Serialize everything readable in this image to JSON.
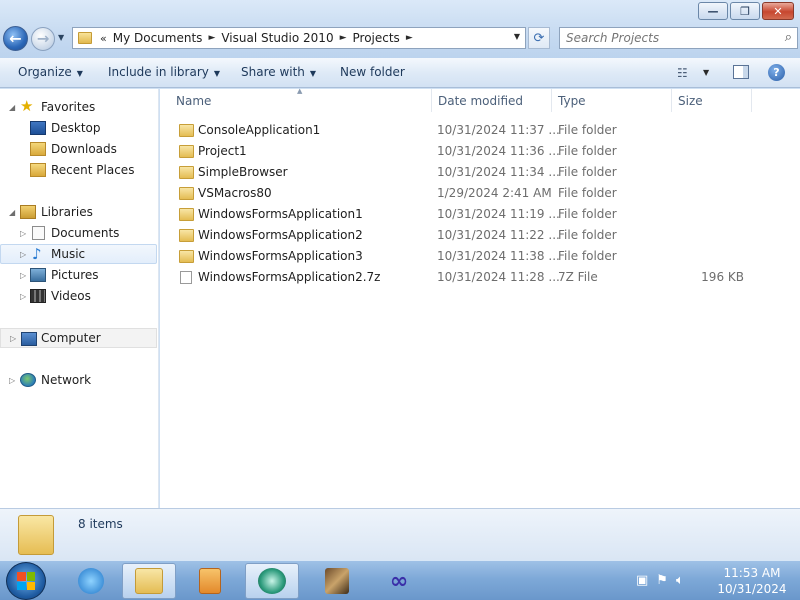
{
  "window": {
    "buttons": {
      "minimize": "—",
      "maximize": "❐",
      "close": "✕"
    }
  },
  "navigation": {
    "back_glyph": "←",
    "forward_glyph": "→",
    "breadcrumb_overflow": "«",
    "breadcrumbs": [
      "My Documents",
      "Visual Studio 2010",
      "Projects"
    ],
    "separator": "►",
    "refresh_glyph": "⟳",
    "search_placeholder": "Search Projects"
  },
  "toolbar": {
    "organize": "Organize",
    "include_in_library": "Include in library",
    "share_with": "Share with",
    "new_folder": "New folder",
    "help": "?"
  },
  "nav_pane": {
    "favorites": "Favorites",
    "desktop": "Desktop",
    "downloads": "Downloads",
    "recent_places": "Recent Places",
    "libraries": "Libraries",
    "documents": "Documents",
    "music": "Music",
    "pictures": "Pictures",
    "videos": "Videos",
    "computer": "Computer",
    "network": "Network"
  },
  "columns": {
    "name": "Name",
    "date_modified": "Date modified",
    "type": "Type",
    "size": "Size"
  },
  "files": [
    {
      "name": "ConsoleApplication1",
      "date": "10/31/2024 11:37 ...",
      "type": "File folder",
      "size": "",
      "kind": "folder"
    },
    {
      "name": "Project1",
      "date": "10/31/2024 11:36 ...",
      "type": "File folder",
      "size": "",
      "kind": "folder"
    },
    {
      "name": "SimpleBrowser",
      "date": "10/31/2024 11:34 ...",
      "type": "File folder",
      "size": "",
      "kind": "folder"
    },
    {
      "name": "VSMacros80",
      "date": "1/29/2024 2:41 AM",
      "type": "File folder",
      "size": "",
      "kind": "folder"
    },
    {
      "name": "WindowsFormsApplication1",
      "date": "10/31/2024 11:19 ...",
      "type": "File folder",
      "size": "",
      "kind": "folder"
    },
    {
      "name": "WindowsFormsApplication2",
      "date": "10/31/2024 11:22 ...",
      "type": "File folder",
      "size": "",
      "kind": "folder"
    },
    {
      "name": "WindowsFormsApplication3",
      "date": "10/31/2024 11:38 ...",
      "type": "File folder",
      "size": "",
      "kind": "folder"
    },
    {
      "name": "WindowsFormsApplication2.7z",
      "date": "10/31/2024 11:28 ...",
      "type": "7Z File",
      "size": "196 KB",
      "kind": "file"
    }
  ],
  "details": {
    "item_count": "8 items"
  },
  "taskbar": {
    "clock_time": "11:53 AM",
    "clock_date": "10/31/2024"
  },
  "colors": {
    "accent": "#1e395b",
    "taskbar": "#7ea9d8",
    "folder": "#e4bc53"
  }
}
